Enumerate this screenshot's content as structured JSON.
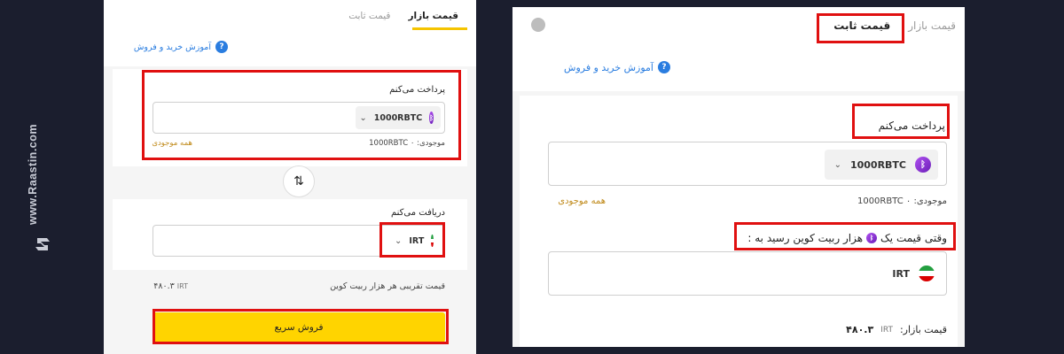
{
  "brand": {
    "text": "www.Raastin.com"
  },
  "left": {
    "tabs": [
      {
        "label": "قیمت بازار"
      },
      {
        "label": "قیمت ثابت"
      }
    ],
    "help": "آموزش خرید و فروش",
    "pay": {
      "label": "پرداخت می‌کنم",
      "currency": "1000RBTC",
      "balance_label": "موجودی:",
      "balance_value": "1000RBTC ۰",
      "all_balance": "همه موجودی"
    },
    "receive": {
      "label": "دریافت می‌کنم",
      "currency": "IRT"
    },
    "estimate": {
      "label": "قیمت تقریبی هر هزار ربیت کوین",
      "value": "۴۸۰.۳",
      "unit": "IRT"
    },
    "sell_button": "فروش سریع"
  },
  "right": {
    "tabs": [
      {
        "label": "قیمت بازار"
      },
      {
        "label": "قیمت ثابت"
      }
    ],
    "help": "آموزش خرید و فروش",
    "pay": {
      "label": "پرداخت می‌کنم",
      "currency": "1000RBTC",
      "balance_label": "موجودی:",
      "balance_value": "1000RBTC ۰",
      "all_balance": "همه موجودی"
    },
    "condition": {
      "before": "وقتی قیمت یک",
      "after": "هزار ربیت کوین رسید به :"
    },
    "target_currency": "IRT",
    "market_price": {
      "label": "قیمت بازار:",
      "unit": "IRT",
      "value": "۴۸۰.۳"
    }
  },
  "colors": {
    "accent": "#ffd400",
    "highlight": "#e01010",
    "link": "#2a7de0",
    "background": "#1b1e2e"
  }
}
